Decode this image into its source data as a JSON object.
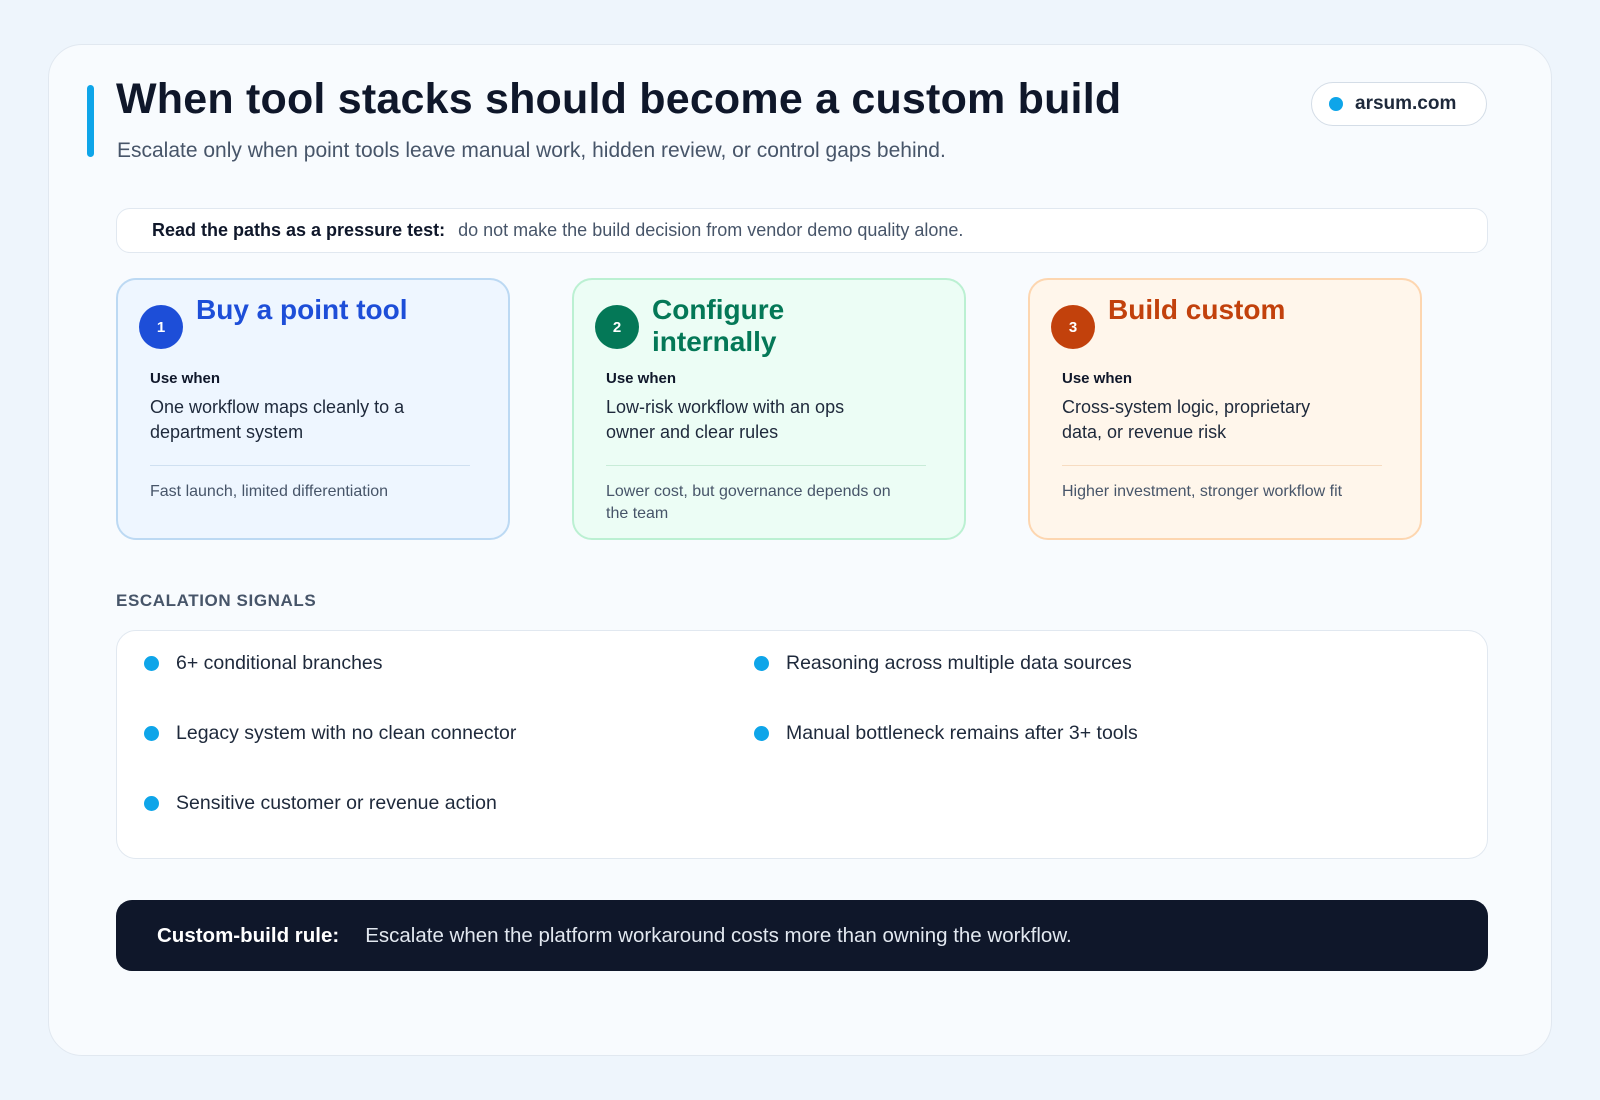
{
  "header": {
    "title": "When tool stacks should become a custom build",
    "subtitle": "Escalate only when point tools leave manual work, hidden review, or control gaps behind.",
    "brand": "arsum.com"
  },
  "note": {
    "label": "Read the paths as a pressure test:",
    "text": "do not make the build decision from vendor demo quality alone."
  },
  "paths": [
    {
      "number": "1",
      "title": "Buy a point tool",
      "use_when_label": "Use when",
      "use_when": "One workflow maps cleanly to a department system",
      "tradeoff": "Fast launch, limited differentiation",
      "color": "#1d4ed8"
    },
    {
      "number": "2",
      "title": "Configure internally",
      "use_when_label": "Use when",
      "use_when": "Low-risk workflow with an ops owner and clear rules",
      "tradeoff": "Lower cost, but governance depends on the team",
      "color": "#047857"
    },
    {
      "number": "3",
      "title": "Build custom",
      "use_when_label": "Use when",
      "use_when": "Cross-system logic, proprietary data, or revenue risk",
      "tradeoff": "Higher investment, stronger workflow fit",
      "color": "#c2410c"
    }
  ],
  "signals": {
    "heading": "ESCALATION SIGNALS",
    "items": [
      "6+ conditional branches",
      "Reasoning across multiple data sources",
      "Legacy system with no clean connector",
      "Manual bottleneck remains after 3+ tools",
      "Sensitive customer or revenue action"
    ]
  },
  "rule": {
    "label": "Custom-build rule:",
    "text": "Escalate when the platform workaround costs more than owning the workflow."
  },
  "colors": {
    "accent": "#0ea5e9",
    "dark": "#0f172a"
  }
}
